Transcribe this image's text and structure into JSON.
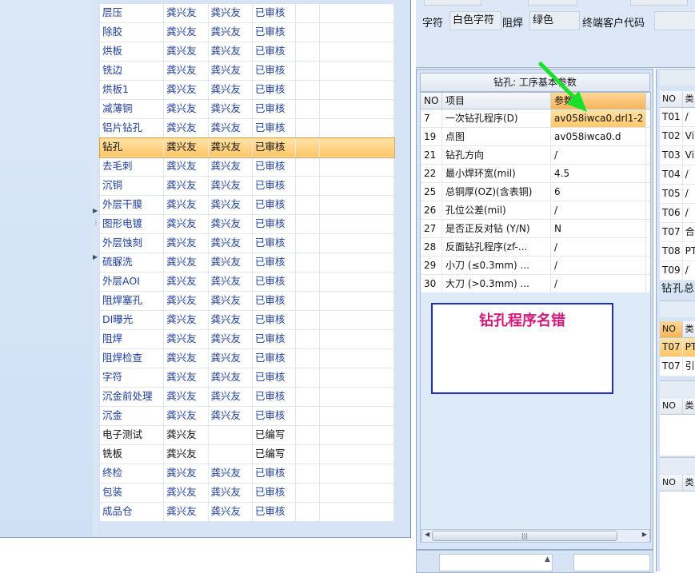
{
  "process_table": {
    "rows": [
      {
        "step": "层压",
        "c2": "龚兴友",
        "c3": "龚兴友",
        "status": "已审核"
      },
      {
        "step": "除胶",
        "c2": "龚兴友",
        "c3": "龚兴友",
        "status": "已审核"
      },
      {
        "step": "烘板",
        "c2": "龚兴友",
        "c3": "龚兴友",
        "status": "已审核"
      },
      {
        "step": "铣边",
        "c2": "龚兴友",
        "c3": "龚兴友",
        "status": "已审核"
      },
      {
        "step": "烘板1",
        "c2": "龚兴友",
        "c3": "龚兴友",
        "status": "已审核"
      },
      {
        "step": "减薄铜",
        "c2": "龚兴友",
        "c3": "龚兴友",
        "status": "已审核"
      },
      {
        "step": "铝片钻孔",
        "c2": "龚兴友",
        "c3": "龚兴友",
        "status": "已审核"
      },
      {
        "step": "钻孔",
        "c2": "龚兴友",
        "c3": "龚兴友",
        "status": "已审核"
      },
      {
        "step": "去毛刺",
        "c2": "龚兴友",
        "c3": "龚兴友",
        "status": "已审核"
      },
      {
        "step": "沉铜",
        "c2": "龚兴友",
        "c3": "龚兴友",
        "status": "已审核"
      },
      {
        "step": "外层干膜",
        "c2": "龚兴友",
        "c3": "龚兴友",
        "status": "已审核"
      },
      {
        "step": "图形电镀",
        "c2": "龚兴友",
        "c3": "龚兴友",
        "status": "已审核"
      },
      {
        "step": "外层蚀刻",
        "c2": "龚兴友",
        "c3": "龚兴友",
        "status": "已审核"
      },
      {
        "step": "硫脲洗",
        "c2": "龚兴友",
        "c3": "龚兴友",
        "status": "已审核"
      },
      {
        "step": "外层AOI",
        "c2": "龚兴友",
        "c3": "龚兴友",
        "status": "已审核"
      },
      {
        "step": "阻焊塞孔",
        "c2": "龚兴友",
        "c3": "龚兴友",
        "status": "已审核"
      },
      {
        "step": "DI曝光",
        "c2": "龚兴友",
        "c3": "龚兴友",
        "status": "已审核"
      },
      {
        "step": "阻焊",
        "c2": "龚兴友",
        "c3": "龚兴友",
        "status": "已审核"
      },
      {
        "step": "阻焊检查",
        "c2": "龚兴友",
        "c3": "龚兴友",
        "status": "已审核"
      },
      {
        "step": "字符",
        "c2": "龚兴友",
        "c3": "龚兴友",
        "status": "已审核"
      },
      {
        "step": "沉金前处理",
        "c2": "龚兴友",
        "c3": "龚兴友",
        "status": "已审核"
      },
      {
        "step": "沉金",
        "c2": "龚兴友",
        "c3": "龚兴友",
        "status": "已审核"
      },
      {
        "step": "电子测试",
        "c2": "龚兴友",
        "c3": "",
        "status": "已编写"
      },
      {
        "step": "铣板",
        "c2": "龚兴友",
        "c3": "",
        "status": "已编写"
      },
      {
        "step": "终检",
        "c2": "龚兴友",
        "c3": "龚兴友",
        "status": "已审核"
      },
      {
        "step": "包装",
        "c2": "龚兴友",
        "c3": "龚兴友",
        "status": "已审核"
      },
      {
        "step": "成品仓",
        "c2": "龚兴友",
        "c3": "龚兴友",
        "status": "已审核"
      }
    ]
  },
  "info": {
    "char_label": "字符",
    "char_value": "白色字符",
    "mask_label": "阻焊",
    "mask_value": "绿色",
    "customer_code_label": "终端客户代码",
    "customer_code_value": ""
  },
  "drill_panel": {
    "title": "钻孔: 工序基本参数",
    "headers": [
      "NO",
      "项目",
      "参数"
    ],
    "rows": [
      {
        "no": "7",
        "item": "一次钻孔程序(D)",
        "value": "av058iwca0.drl1-2"
      },
      {
        "no": "19",
        "item": "点图",
        "value": "av058iwca0.d"
      },
      {
        "no": "21",
        "item": "钻孔方向",
        "value": "/"
      },
      {
        "no": "22",
        "item": "最小焊环宽(mil)",
        "value": "4.5"
      },
      {
        "no": "25",
        "item": "总铜厚(OZ)(含表铜)",
        "value": "6"
      },
      {
        "no": "26",
        "item": "孔位公差(mil)",
        "value": "/"
      },
      {
        "no": "27",
        "item": "是否正反对钻 (Y/N)",
        "value": "N"
      },
      {
        "no": "28",
        "item": "反面钻孔程序(zf-...",
        "value": "/"
      },
      {
        "no": "29",
        "item": "小刀 (≤0.3mm) ...",
        "value": "/"
      },
      {
        "no": "30",
        "item": "大刀 (>0.3mm) ...",
        "value": "/"
      }
    ]
  },
  "annotation": {
    "text": "钻孔程序名错",
    "text_color": "#d11a7a",
    "border_color": "#1d2fb8",
    "arrow_color": "#19e02a"
  },
  "tool_panel": {
    "header_no": "NO",
    "header_type": "类",
    "rows": [
      {
        "no": "T01",
        "v": "/"
      },
      {
        "no": "T02",
        "v": "Vi"
      },
      {
        "no": "T03",
        "v": "Vi"
      },
      {
        "no": "T04",
        "v": "/"
      },
      {
        "no": "T05",
        "v": "/"
      },
      {
        "no": "T06",
        "v": "/"
      },
      {
        "no": "T07",
        "v": "合"
      },
      {
        "no": "T08",
        "v": "PT"
      },
      {
        "no": "T09",
        "v": "/"
      }
    ],
    "summary": "钻孔总",
    "grid2_rows": [
      {
        "no": "T07",
        "v": "PT"
      },
      {
        "no": "T07",
        "v": "引"
      }
    ]
  }
}
